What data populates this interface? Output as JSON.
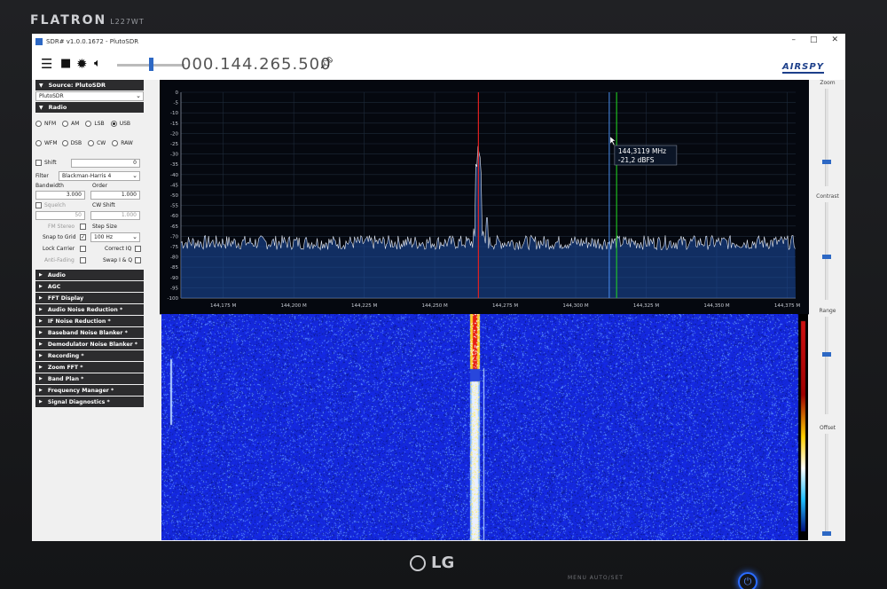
{
  "monitor": {
    "brand": "FLATRON",
    "model": "L227WT",
    "logo": "LG",
    "buttons": "MENU  AUTO/SET"
  },
  "window": {
    "title": "SDR# v1.0.0.1672 - PlutoSDR",
    "controls": [
      "–",
      "□",
      "✕"
    ]
  },
  "toolbar": {
    "frequency": "000.144.265.500",
    "logo": "AIRSPY",
    "icons": [
      "menu-icon",
      "stop-icon",
      "gear-icon",
      "speaker-icon",
      "pin-icon"
    ]
  },
  "source": {
    "header": "Source: PlutoSDR",
    "device": "PlutoSDR"
  },
  "radio": {
    "header": "Radio",
    "modes_row1": [
      {
        "label": "NFM",
        "selected": false
      },
      {
        "label": "AM",
        "selected": false
      },
      {
        "label": "LSB",
        "selected": false
      },
      {
        "label": "USB",
        "selected": true
      }
    ],
    "modes_row2": [
      {
        "label": "WFM",
        "selected": false
      },
      {
        "label": "DSB",
        "selected": false
      },
      {
        "label": "CW",
        "selected": false
      },
      {
        "label": "RAW",
        "selected": false
      }
    ],
    "shift_label": "Shift",
    "shift_value": "0",
    "filter_label": "Filter",
    "filter_value": "Blackman-Harris 4",
    "bandwidth_label": "Bandwidth",
    "bandwidth_value": "3.000",
    "order_label": "Order",
    "order_value": "1.000",
    "squelch_label": "Squelch",
    "cw_shift_label": "CW Shift",
    "squelch_value": "50",
    "cw_shift_value": "1.000",
    "fm_stereo_label": "FM Stereo",
    "step_size_label": "Step Size",
    "snap_label": "Snap to Grid",
    "snap_checked": true,
    "step_value": "100 Hz",
    "lock_carrier_label": "Lock Carrier",
    "correct_iq_label": "Correct IQ",
    "anti_fading_label": "Anti-Fading",
    "swap_iq_label": "Swap I & Q"
  },
  "panels": [
    "Audio",
    "AGC",
    "FFT Display",
    "Audio Noise Reduction *",
    "IF Noise Reduction *",
    "Baseband Noise Blanker *",
    "Demodulator Noise Blanker *",
    "Recording *",
    "Zoom FFT *",
    "Band Plan *",
    "Frequency Manager *",
    "Signal Diagnostics *"
  ],
  "spectrum": {
    "y_ticks": [
      "0",
      "-5",
      "-10",
      "-15",
      "-20",
      "-25",
      "-30",
      "-35",
      "-40",
      "-45",
      "-50",
      "-55",
      "-60",
      "-65",
      "-70",
      "-75",
      "-80",
      "-85",
      "-90",
      "-95",
      "-100"
    ],
    "y_range": [
      -100,
      0
    ],
    "x_ticks": [
      "144,175 M",
      "144,200 M",
      "144,225 M",
      "144,250 M",
      "144,275 M",
      "144,300 M",
      "144,325 M",
      "144,350 M",
      "144,375 M"
    ],
    "x_tick_values": [
      144.175,
      144.2,
      144.225,
      144.25,
      144.275,
      144.3,
      144.325,
      144.35,
      144.375
    ],
    "x_range_mhz": [
      144.16,
      144.378
    ],
    "noise_floor_dbfs": -73,
    "signal": {
      "center_mhz": 144.2655,
      "peak_dbfs": -28,
      "secondary_dbfs": -38,
      "width_khz": 2.5
    },
    "side_spur_mhz": 144.2685,
    "tuned_marker_mhz": 144.2655,
    "cursor_marker_mhz": 144.3119,
    "green_marker_mhz": 144.3145,
    "tooltip_freq": "144,3119 MHz",
    "tooltip_level": "-21,2 dBFS",
    "colors": {
      "tuned": "#e02020",
      "cursor": "#4a8ef0",
      "green": "#22dd22",
      "trace": "#e8ecf4",
      "fill": "#1b4fa8"
    }
  },
  "sidebar_right": {
    "zoom_label": "Zoom",
    "contrast_label": "Contrast",
    "range_label": "Range",
    "offset_label": "Offset"
  }
}
